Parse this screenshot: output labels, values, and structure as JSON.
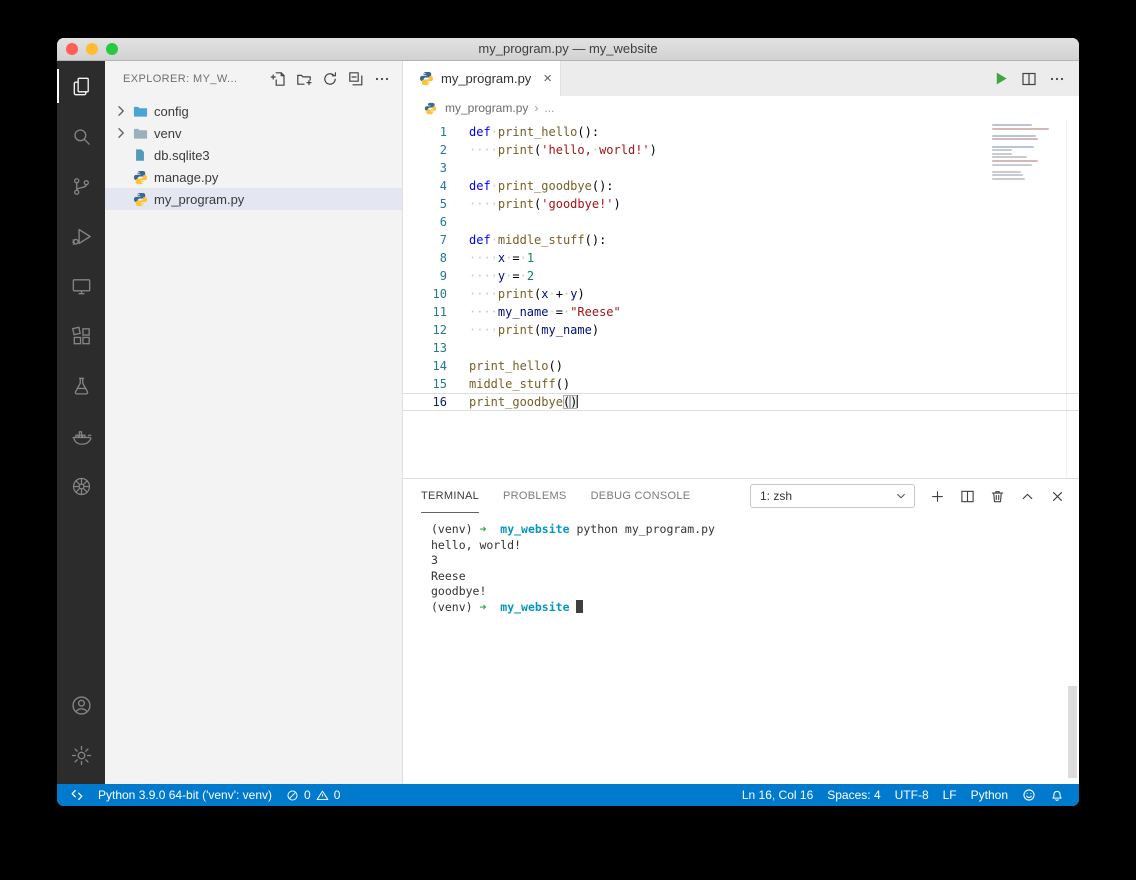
{
  "window": {
    "title": "my_program.py — my_website"
  },
  "activity_bar": {
    "top": [
      {
        "id": "explorer",
        "icon": "files",
        "active": true
      },
      {
        "id": "search",
        "icon": "search"
      },
      {
        "id": "source-control",
        "icon": "branch"
      },
      {
        "id": "run-and-debug",
        "icon": "debug"
      },
      {
        "id": "remote-explorer",
        "icon": "monitor"
      },
      {
        "id": "extensions",
        "icon": "extensions"
      },
      {
        "id": "testing",
        "icon": "beaker"
      },
      {
        "id": "docker",
        "icon": "whale"
      },
      {
        "id": "kubernetes",
        "icon": "wheel"
      }
    ],
    "bottom": [
      {
        "id": "accounts",
        "icon": "account"
      },
      {
        "id": "settings",
        "icon": "gear"
      }
    ]
  },
  "sidebar": {
    "header": "EXPLORER: MY_W...",
    "tree": [
      {
        "label": "config",
        "icon": "folder",
        "color": "#4ba3d3",
        "chevron": true
      },
      {
        "label": "venv",
        "icon": "folder",
        "color": "#9bb0bc",
        "chevron": true
      },
      {
        "label": "db.sqlite3",
        "icon": "filedoc",
        "color": "#519aba"
      },
      {
        "label": "manage.py",
        "icon": "python"
      },
      {
        "label": "my_program.py",
        "icon": "python",
        "selected": true
      }
    ]
  },
  "editor": {
    "tab": {
      "label": "my_program.py",
      "close": "×"
    },
    "breadcrumb": {
      "file": "my_program.py",
      "sep": "›",
      "more": "..."
    },
    "code": [
      {
        "num": "1",
        "tokens": [
          {
            "c": "kw",
            "t": "def"
          },
          {
            "c": "ws",
            "t": "·"
          },
          {
            "c": "fn",
            "t": "print_hello"
          },
          {
            "c": "pn",
            "t": "():"
          }
        ]
      },
      {
        "num": "2",
        "tokens": [
          {
            "c": "ws",
            "t": "····"
          },
          {
            "c": "fn",
            "t": "print"
          },
          {
            "c": "pn",
            "t": "("
          },
          {
            "c": "st",
            "t": "'hello,"
          },
          {
            "c": "ws",
            "t": "·"
          },
          {
            "c": "st",
            "t": "world!'"
          },
          {
            "c": "pn",
            "t": ")"
          }
        ]
      },
      {
        "num": "3",
        "tokens": []
      },
      {
        "num": "4",
        "tokens": [
          {
            "c": "kw",
            "t": "def"
          },
          {
            "c": "ws",
            "t": "·"
          },
          {
            "c": "fn",
            "t": "print_goodbye"
          },
          {
            "c": "pn",
            "t": "():"
          }
        ]
      },
      {
        "num": "5",
        "tokens": [
          {
            "c": "ws",
            "t": "····"
          },
          {
            "c": "fn",
            "t": "print"
          },
          {
            "c": "pn",
            "t": "("
          },
          {
            "c": "st",
            "t": "'goodbye!'"
          },
          {
            "c": "pn",
            "t": ")"
          }
        ]
      },
      {
        "num": "6",
        "tokens": []
      },
      {
        "num": "7",
        "tokens": [
          {
            "c": "kw",
            "t": "def"
          },
          {
            "c": "ws",
            "t": "·"
          },
          {
            "c": "fn",
            "t": "middle_stuff"
          },
          {
            "c": "pn",
            "t": "():"
          }
        ]
      },
      {
        "num": "8",
        "tokens": [
          {
            "c": "ws",
            "t": "····"
          },
          {
            "c": "vr",
            "t": "x"
          },
          {
            "c": "ws",
            "t": "·"
          },
          {
            "c": "pn",
            "t": "="
          },
          {
            "c": "ws",
            "t": "·"
          },
          {
            "c": "nm",
            "t": "1"
          }
        ]
      },
      {
        "num": "9",
        "tokens": [
          {
            "c": "ws",
            "t": "····"
          },
          {
            "c": "vr",
            "t": "y"
          },
          {
            "c": "ws",
            "t": "·"
          },
          {
            "c": "pn",
            "t": "="
          },
          {
            "c": "ws",
            "t": "·"
          },
          {
            "c": "nm",
            "t": "2"
          }
        ]
      },
      {
        "num": "10",
        "tokens": [
          {
            "c": "ws",
            "t": "····"
          },
          {
            "c": "fn",
            "t": "print"
          },
          {
            "c": "pn",
            "t": "("
          },
          {
            "c": "vr",
            "t": "x"
          },
          {
            "c": "ws",
            "t": "·"
          },
          {
            "c": "pn",
            "t": "+"
          },
          {
            "c": "ws",
            "t": "·"
          },
          {
            "c": "vr",
            "t": "y"
          },
          {
            "c": "pn",
            "t": ")"
          }
        ]
      },
      {
        "num": "11",
        "tokens": [
          {
            "c": "ws",
            "t": "····"
          },
          {
            "c": "vr",
            "t": "my_name"
          },
          {
            "c": "ws",
            "t": "·"
          },
          {
            "c": "pn",
            "t": "="
          },
          {
            "c": "ws",
            "t": "·"
          },
          {
            "c": "st",
            "t": "\"Reese\""
          }
        ]
      },
      {
        "num": "12",
        "tokens": [
          {
            "c": "ws",
            "t": "····"
          },
          {
            "c": "fn",
            "t": "print"
          },
          {
            "c": "pn",
            "t": "("
          },
          {
            "c": "vr",
            "t": "my_name"
          },
          {
            "c": "pn",
            "t": ")"
          }
        ]
      },
      {
        "num": "13",
        "tokens": []
      },
      {
        "num": "14",
        "tokens": [
          {
            "c": "fn",
            "t": "print_hello"
          },
          {
            "c": "pn",
            "t": "()"
          }
        ]
      },
      {
        "num": "15",
        "tokens": [
          {
            "c": "fn",
            "t": "middle_stuff"
          },
          {
            "c": "pn",
            "t": "()"
          }
        ]
      },
      {
        "num": "16",
        "current": true,
        "tokens": [
          {
            "c": "fn",
            "t": "print_goodbye"
          },
          {
            "c": "bm",
            "t": "("
          },
          {
            "c": "bm",
            "t": ")"
          },
          {
            "c": "cr",
            "t": ""
          }
        ]
      }
    ]
  },
  "panel": {
    "tabs": [
      {
        "label": "TERMINAL",
        "active": true
      },
      {
        "label": "PROBLEMS"
      },
      {
        "label": "DEBUG CONSOLE"
      }
    ],
    "shell_label": "1: zsh",
    "terminal": [
      {
        "tokens": [
          {
            "c": "pl",
            "t": "(venv) "
          },
          {
            "c": "ar",
            "t": "➜"
          },
          {
            "c": "pl",
            "t": "  "
          },
          {
            "c": "cy",
            "t": "my_website"
          },
          {
            "c": "pl",
            "t": " python my_program.py"
          }
        ]
      },
      {
        "tokens": [
          {
            "c": "pl",
            "t": "hello, world!"
          }
        ]
      },
      {
        "tokens": [
          {
            "c": "pl",
            "t": "3"
          }
        ]
      },
      {
        "tokens": [
          {
            "c": "pl",
            "t": "Reese"
          }
        ]
      },
      {
        "tokens": [
          {
            "c": "pl",
            "t": "goodbye!"
          }
        ]
      },
      {
        "tokens": [
          {
            "c": "pl",
            "t": "(venv) "
          },
          {
            "c": "ar",
            "t": "➜"
          },
          {
            "c": "pl",
            "t": "  "
          },
          {
            "c": "cy",
            "t": "my_website"
          },
          {
            "c": "pl",
            "t": " "
          },
          {
            "c": "cur",
            "t": " "
          }
        ]
      }
    ]
  },
  "status_bar": {
    "interpreter": "Python 3.9.0 64-bit ('venv': venv)",
    "errors": "0",
    "warnings": "0",
    "right": [
      "Ln 16, Col 16",
      "Spaces: 4",
      "UTF-8",
      "LF",
      "Python"
    ]
  },
  "colors": {
    "statusbar": "#007acc",
    "keyword": "#0000ff",
    "string": "#a31515",
    "number": "#098658",
    "function": "#795e26",
    "variable": "#001080",
    "terminal_arrow_green": "#2aa840",
    "terminal_dir_cyan": "#0598bc",
    "selection_bg": "#e4e6f1"
  }
}
